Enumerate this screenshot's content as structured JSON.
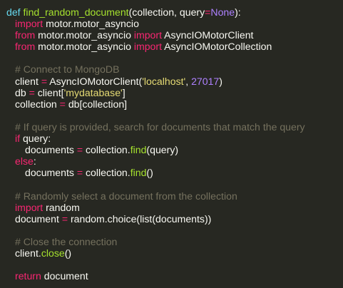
{
  "code": {
    "line_1": {
      "kw": "def",
      "name": "find_random_document",
      "params_open": "(collection, query",
      "eq": "=",
      "none": "None",
      "params_close": "):"
    },
    "line_2": {
      "kw": "import",
      "module": " motor.motor_asyncio"
    },
    "line_3": {
      "kw_from": "from",
      "module": " motor.motor_asyncio ",
      "kw_import": "import",
      "name": " AsyncIOMotorClient"
    },
    "line_4": {
      "kw_from": "from",
      "module": " motor.motor_asyncio ",
      "kw_import": "import",
      "name": " AsyncIOMotorCollection"
    },
    "line_6": {
      "comment": "# Connect to MongoDB"
    },
    "line_7": {
      "var": "client ",
      "eq": "=",
      "call": " AsyncIOMotorClient(",
      "str": "'localhost'",
      "sep": ", ",
      "num": "27017",
      "close": ")"
    },
    "line_8": {
      "var": "db ",
      "eq": "=",
      "pre": " client[",
      "str": "'mydatabase'",
      "post": "]"
    },
    "line_9": {
      "var": "collection ",
      "eq": "=",
      "rest": " db[collection]"
    },
    "line_11": {
      "comment": "# If query is provided, search for documents that match the query"
    },
    "line_12": {
      "kw": "if",
      "rest": " query:"
    },
    "line_13": {
      "var": "documents ",
      "eq": "=",
      "pre": " collection.",
      "method": "find",
      "post": "(query)"
    },
    "line_14": {
      "kw": "else",
      "rest": ":"
    },
    "line_15": {
      "var": "documents ",
      "eq": "=",
      "pre": " collection.",
      "method": "find",
      "post": "()"
    },
    "line_17": {
      "comment": "# Randomly select a document from the collection"
    },
    "line_18": {
      "kw": "import",
      "module": " random"
    },
    "line_19": {
      "var": "document ",
      "eq": "=",
      "rest": " random.choice(list(documents))"
    },
    "line_21": {
      "comment": "# Close the connection"
    },
    "line_22": {
      "pre": "client.",
      "method": "close",
      "post": "()"
    },
    "line_24": {
      "kw": "return",
      "rest": " document"
    }
  },
  "colors": {
    "background": "#272822",
    "text": "#f8f8f2",
    "keyword": "#f92672",
    "definition": "#66d9ef",
    "function": "#a6e22e",
    "string": "#e6db74",
    "number": "#ae81ff",
    "comment": "#75715e"
  }
}
